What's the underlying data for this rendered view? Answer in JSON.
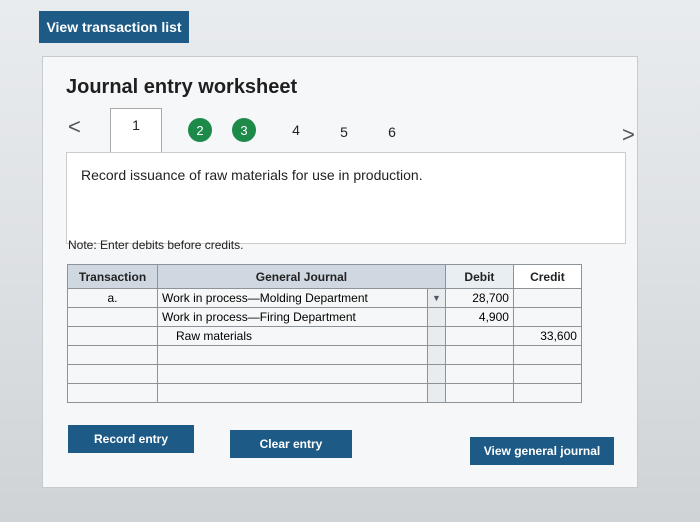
{
  "top_button": {
    "label": "View transaction list"
  },
  "worksheet": {
    "title": "Journal entry worksheet",
    "steps": [
      "1",
      "2",
      "3",
      "4",
      "5",
      "6"
    ],
    "instruction": "Record issuance of raw materials for use in production.",
    "note": "Note: Enter debits before credits."
  },
  "table": {
    "headers": {
      "transaction": "Transaction",
      "general_journal": "General Journal",
      "debit": "Debit",
      "credit": "Credit"
    },
    "rows": [
      {
        "txn": "a.",
        "account": "Work in process—Molding Department",
        "debit": "28,700",
        "credit": ""
      },
      {
        "txn": "",
        "account": "Work in process—Firing Department",
        "debit": "4,900",
        "credit": ""
      },
      {
        "txn": "",
        "account": "Raw materials",
        "debit": "",
        "credit": "33,600"
      },
      {
        "txn": "",
        "account": "",
        "debit": "",
        "credit": ""
      },
      {
        "txn": "",
        "account": "",
        "debit": "",
        "credit": ""
      },
      {
        "txn": "",
        "account": "",
        "debit": "",
        "credit": ""
      }
    ]
  },
  "buttons": {
    "record": "Record entry",
    "clear": "Clear entry",
    "view_journal": "View general journal"
  }
}
